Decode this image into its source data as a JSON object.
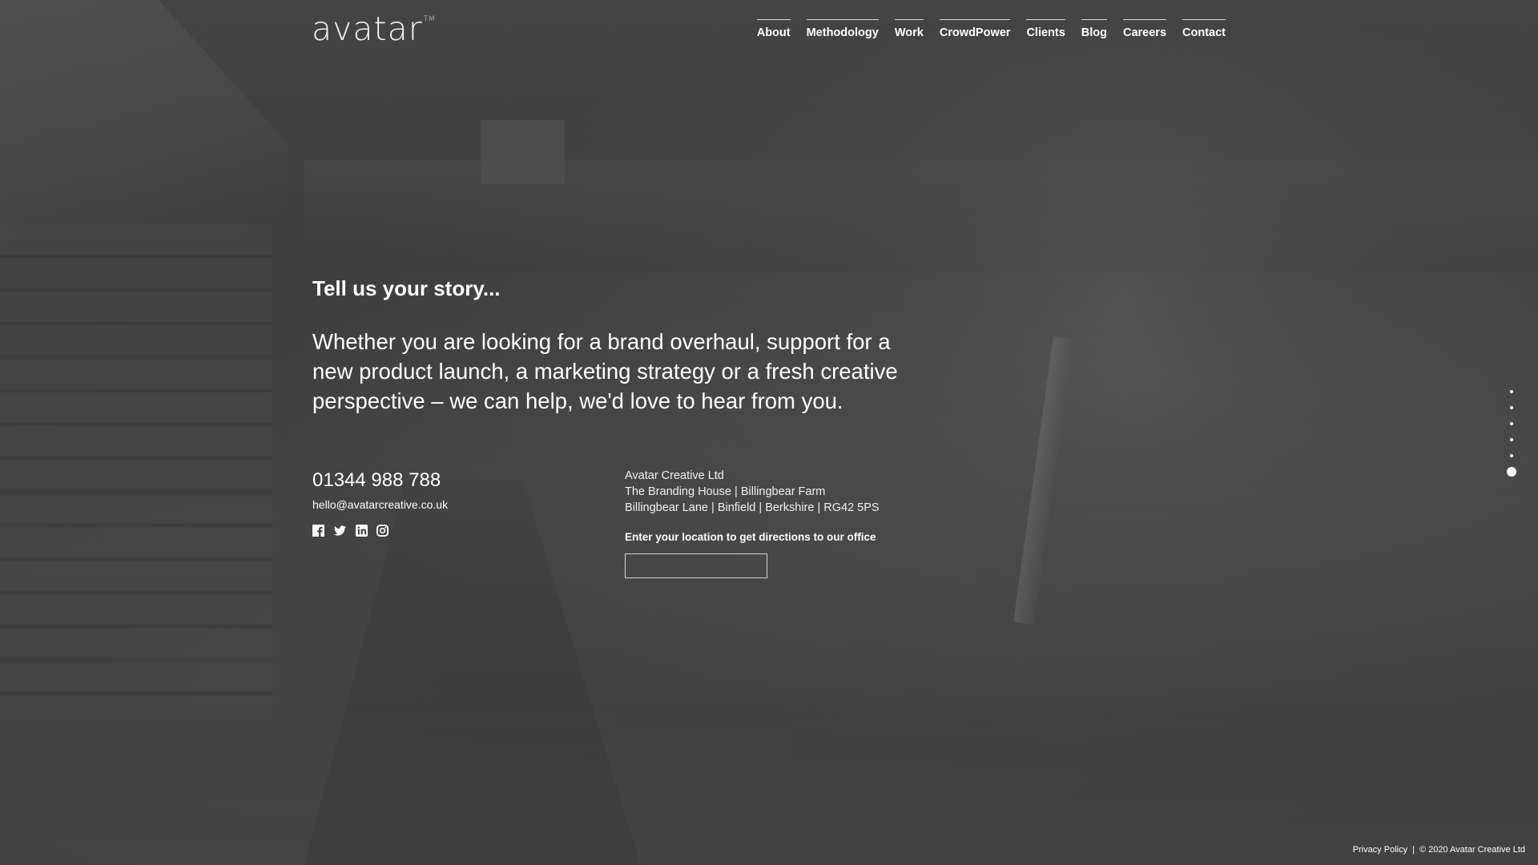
{
  "brand": {
    "logo_text": "avatar",
    "logo_mark": "TM"
  },
  "nav": {
    "items": [
      {
        "label": "About"
      },
      {
        "label": "Methodology"
      },
      {
        "label": "Work"
      },
      {
        "label": "CrowdPower"
      },
      {
        "label": "Clients"
      },
      {
        "label": "Blog"
      },
      {
        "label": "Careers"
      },
      {
        "label": "Contact"
      }
    ]
  },
  "main": {
    "heading": "Tell us your story...",
    "intro": "Whether you are looking for a brand overhaul, support for a new product launch, a marketing strategy or a fresh creative perspective – we can help, we'd love to hear from you."
  },
  "contact": {
    "phone": "01344 988 788",
    "email": "hello@avatarcreative.co.uk",
    "social": [
      {
        "icon": "facebook-icon"
      },
      {
        "icon": "twitter-icon"
      },
      {
        "icon": "linkedin-icon"
      },
      {
        "icon": "instagram-icon"
      }
    ]
  },
  "address": {
    "company": "Avatar Creative Ltd",
    "line1": "The Branding House | Billingbear Farm",
    "line2": "Billingbear Lane | Binfield | Berkshire | RG42 5PS",
    "directions_label": "Enter your location to get directions to our office",
    "directions_value": ""
  },
  "pager": {
    "total": 6,
    "active_index": 5
  },
  "footer": {
    "privacy": "Privacy Policy",
    "separator": "|",
    "copyright": "© 2020 Avatar Creative Ltd"
  },
  "colors": {
    "background": "#3f3f3f",
    "text": "#ffffff"
  }
}
